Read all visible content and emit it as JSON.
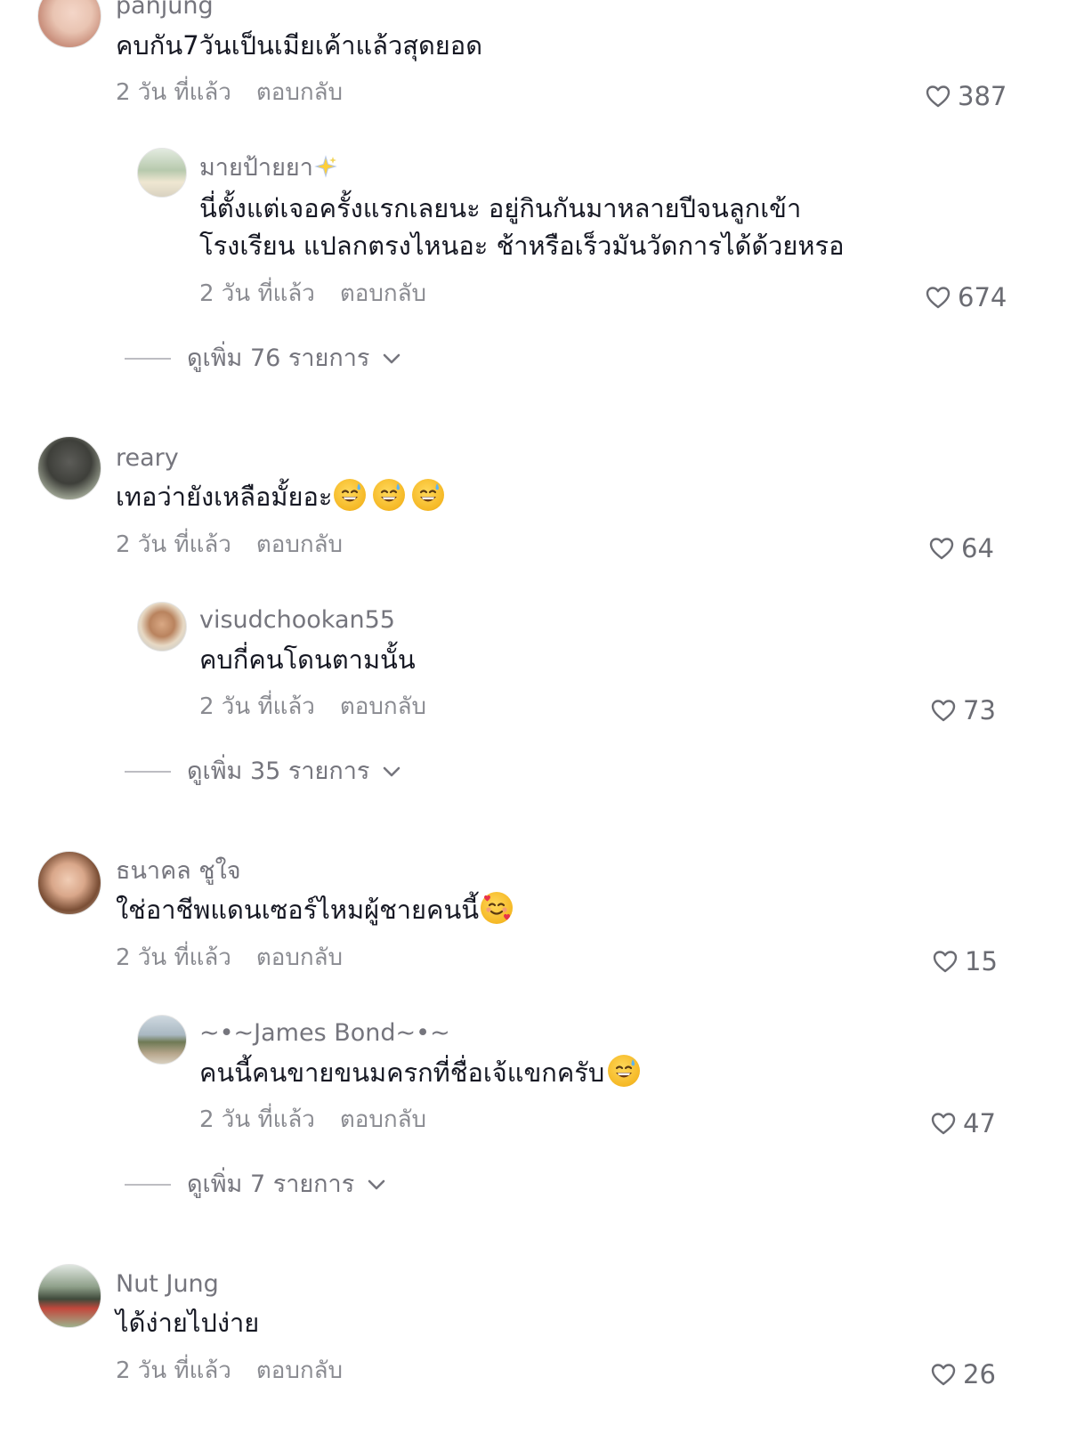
{
  "comments": [
    {
      "username": "panjung",
      "text": "คบกัน7วันเป็นเมียเค้าแล้วสุดยอด",
      "time": "2 วัน ที่แล้ว",
      "reply_label": "ตอบกลับ",
      "likes": "387",
      "reply": {
        "username": "มายป้ายยา",
        "text_line1": "นี่ตั้งแต่เจอครั้งแรกเลยนะ อยู่กินกันมาหลายปีจนลูกเข้า",
        "text_line2": "โรงเรียน แปลกตรงไหนอะ ช้าหรือเร็วมันวัดการได้ด้วยหรอ",
        "time": "2 วัน ที่แล้ว",
        "reply_label": "ตอบกลับ",
        "likes": "674"
      },
      "more_replies": "ดูเพิ่ม 76 รายการ"
    },
    {
      "username": "reary",
      "text": "เทอว่ายังเหลือมั้ยอะ",
      "time": "2 วัน ที่แล้ว",
      "reply_label": "ตอบกลับ",
      "likes": "64",
      "reply": {
        "username": "visudchookan55",
        "text": "คบกี่คนโดนตามนั้น",
        "time": "2 วัน ที่แล้ว",
        "reply_label": "ตอบกลับ",
        "likes": "73"
      },
      "more_replies": "ดูเพิ่ม 35 รายการ"
    },
    {
      "username": "ธนาคล ชูใจ",
      "text": "ใช่อาชีพแดนเซอร์ไหมผู้ชายคนนี้",
      "time": "2 วัน ที่แล้ว",
      "reply_label": "ตอบกลับ",
      "likes": "15",
      "reply": {
        "username": "~•~James Bond~•~",
        "text": "คนนี้คนขายขนมครกที่ชื่อเจ้แขกครับ",
        "time": "2 วัน ที่แล้ว",
        "reply_label": "ตอบกลับ",
        "likes": "47"
      },
      "more_replies": "ดูเพิ่ม 7 รายการ"
    },
    {
      "username": "Nut Jung",
      "text": "ได้ง่ายไปง่าย",
      "time": "2 วัน ที่แล้ว",
      "reply_label": "ตอบกลับ",
      "likes": "26"
    }
  ],
  "icons": {
    "like": "heart-outline-icon",
    "expand": "chevron-down-icon",
    "sweat_smile": "grinning-sweat-emoji",
    "smiling_hearts": "smiling-face-with-hearts-emoji",
    "sparkles": "sparkles-emoji"
  }
}
